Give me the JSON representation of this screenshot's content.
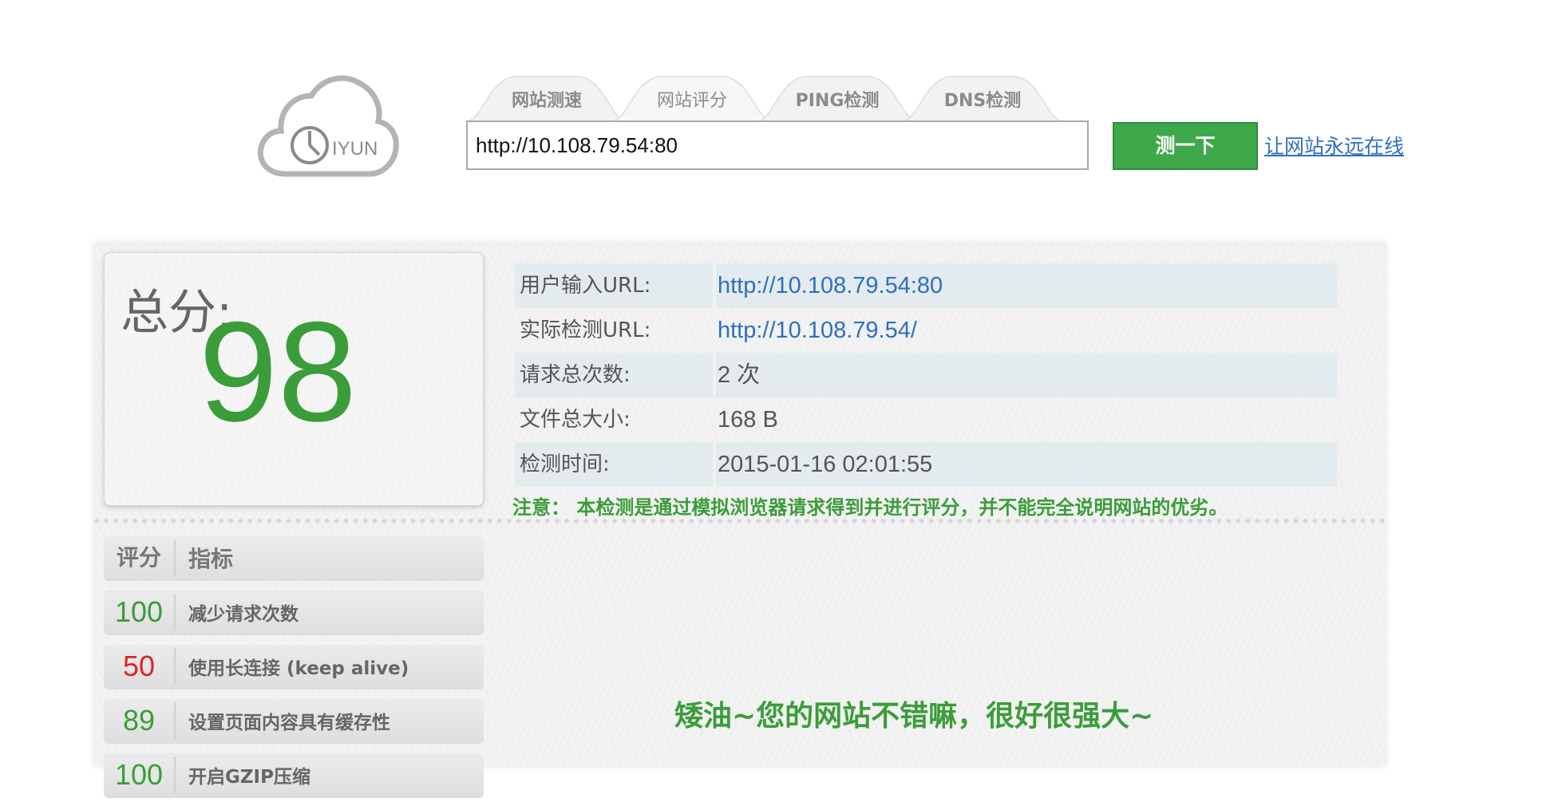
{
  "header": {
    "logo_text": "IYUN",
    "tabs": [
      {
        "label": "网站测速"
      },
      {
        "label": "网站评分"
      },
      {
        "label": "PING检测"
      },
      {
        "label": "DNS检测"
      }
    ],
    "url_value": "http://10.108.79.54:80",
    "test_button": "测一下",
    "link": "让网站永远在线"
  },
  "score": {
    "label": "总分:",
    "value": "98"
  },
  "info": [
    {
      "key": "用户输入URL:",
      "value": "http://10.108.79.54:80"
    },
    {
      "key": "实际检测URL:",
      "value": "http://10.108.79.54/"
    },
    {
      "key": "请求总次数:",
      "value": "2 次"
    },
    {
      "key": "文件总大小:",
      "value": "168 B"
    },
    {
      "key": "检测时间:",
      "value": "2015-01-16 02:01:55"
    }
  ],
  "notice": "注意： 本检测是通过模拟浏览器请求得到并进行评分，并不能完全说明网站的优劣。",
  "metrics": {
    "header": {
      "score": "评分",
      "name": "指标"
    },
    "rows": [
      {
        "score": "100",
        "name": "减少请求次数"
      },
      {
        "score": "50",
        "name": "使用长连接 (keep alive)"
      },
      {
        "score": "89",
        "name": "设置页面内容具有缓存性"
      },
      {
        "score": "100",
        "name": "开启GZIP压缩"
      }
    ]
  },
  "praise": "矮油~您的网站不错嘛，很好很强大~",
  "colors": {
    "accent_green": "#3a9d3a",
    "button_green": "#3ea94a",
    "warn_red": "#e02424",
    "link_blue": "#2f6fbf"
  }
}
